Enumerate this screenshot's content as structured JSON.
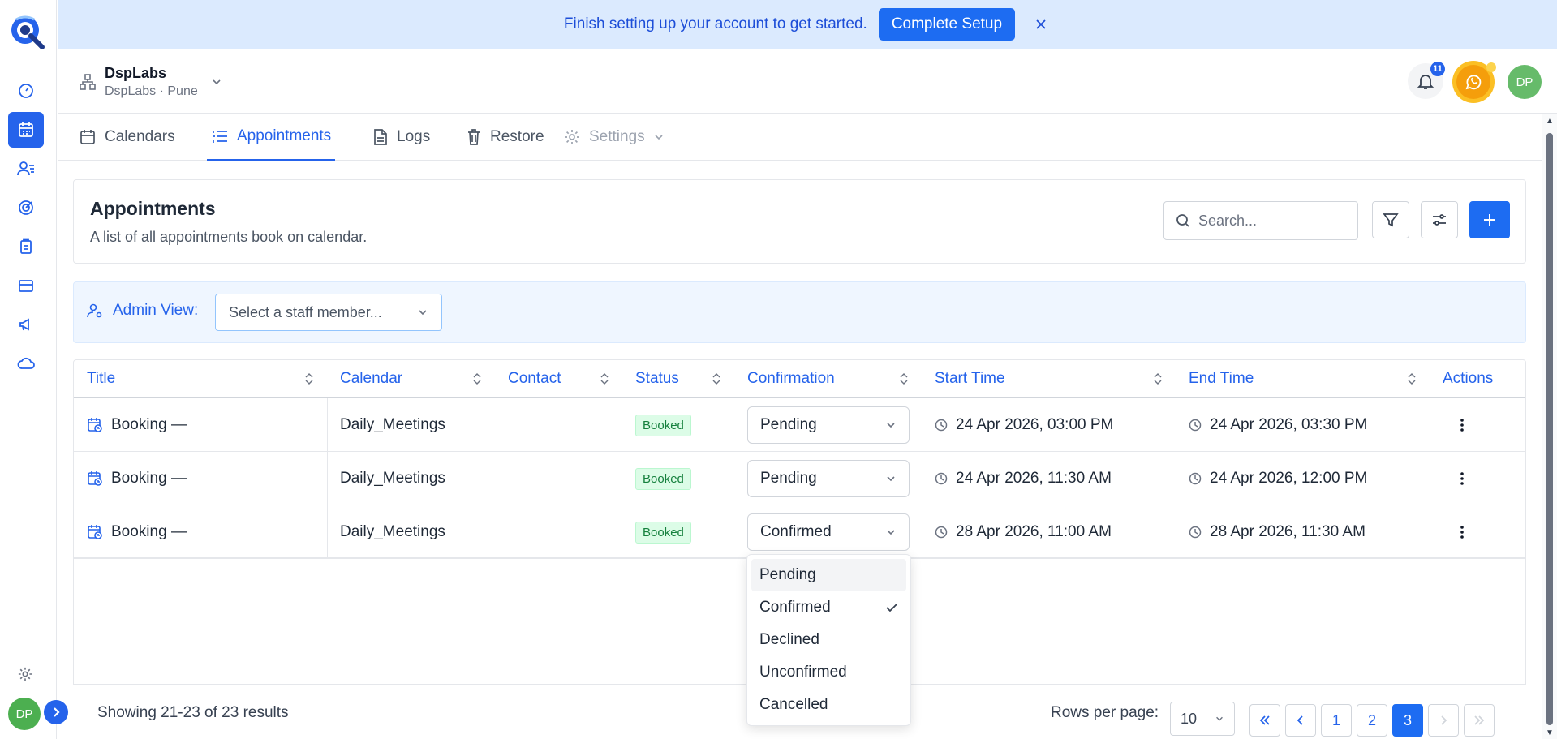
{
  "banner": {
    "message": "Finish setting up your account to get started.",
    "cta": "Complete Setup"
  },
  "org": {
    "name": "DspLabs",
    "location": "DspLabs · Pune"
  },
  "notifications": {
    "count": "11"
  },
  "user": {
    "initials": "DP"
  },
  "tabs": [
    {
      "label": "Calendars",
      "icon": "calendar-icon"
    },
    {
      "label": "Appointments",
      "icon": "list-icon"
    },
    {
      "label": "Logs",
      "icon": "document-icon"
    },
    {
      "label": "Restore",
      "icon": "trash-icon"
    },
    {
      "label": "Settings",
      "icon": "gear-icon"
    }
  ],
  "page": {
    "title": "Appointments",
    "description": "A list of all appointments book on calendar."
  },
  "search": {
    "placeholder": "Search..."
  },
  "admin_view": {
    "label": "Admin View:",
    "placeholder": "Select a staff member..."
  },
  "table": {
    "columns": [
      "Title",
      "Calendar",
      "Contact",
      "Status",
      "Confirmation",
      "Start Time",
      "End Time",
      "Actions"
    ],
    "rows": [
      {
        "title": "Booking —",
        "calendar": "Daily_Meetings",
        "contact": "",
        "status": "Booked",
        "confirmation": "Pending",
        "start": "24 Apr 2026, 03:00 PM",
        "end": "24 Apr 2026, 03:30 PM"
      },
      {
        "title": "Booking —",
        "calendar": "Daily_Meetings",
        "contact": "",
        "status": "Booked",
        "confirmation": "Pending",
        "start": "24 Apr 2026, 11:30 AM",
        "end": "24 Apr 2026, 12:00 PM"
      },
      {
        "title": "Booking —",
        "calendar": "Daily_Meetings",
        "contact": "",
        "status": "Booked",
        "confirmation": "Confirmed",
        "start": "28 Apr 2026, 11:00 AM",
        "end": "28 Apr 2026, 11:30 AM"
      }
    ]
  },
  "confirmation_menu": {
    "options": [
      "Pending",
      "Confirmed",
      "Declined",
      "Unconfirmed",
      "Cancelled"
    ],
    "selected": "Confirmed",
    "hovered": "Pending"
  },
  "footer": {
    "info": "Showing 21-23 of 23 results",
    "rows_per_page_label": "Rows per page:",
    "rows_per_page": "10",
    "pages": [
      "1",
      "2",
      "3"
    ],
    "current_page": "3"
  },
  "colors": {
    "primary": "#1d6cf2",
    "banner_bg": "#dbeafe",
    "booked_bg": "#dcfce7",
    "booked_text": "#15803d"
  }
}
